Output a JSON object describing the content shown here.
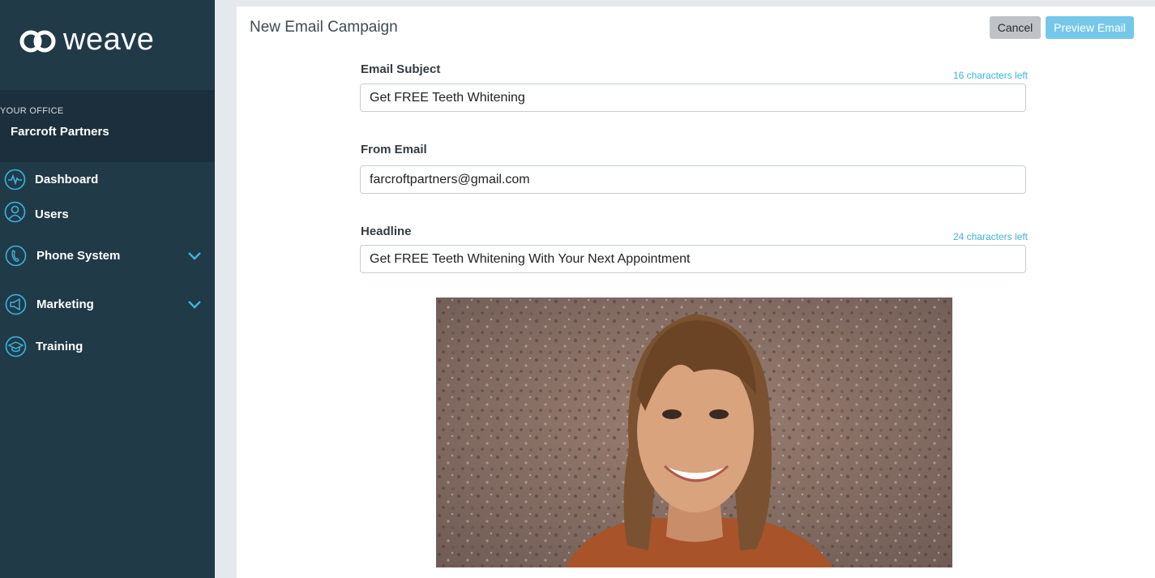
{
  "brand": {
    "name": "weave",
    "accent": "#3cb3df",
    "sidebar_bg": "#213a48"
  },
  "office": {
    "label": "YOUR OFFICE",
    "name": "Farcroft Partners"
  },
  "nav": [
    {
      "label": "Dashboard",
      "icon": "pulse-icon"
    },
    {
      "label": "Users",
      "icon": "user-icon"
    },
    {
      "label": "Phone System",
      "icon": "phone-icon",
      "expandable": true
    },
    {
      "label": "Marketing",
      "icon": "megaphone-icon",
      "expandable": true
    },
    {
      "label": "Training",
      "icon": "graduation-cap-icon"
    }
  ],
  "page": {
    "title": "New Email Campaign",
    "cancel_label": "Cancel",
    "preview_label": "Preview Email"
  },
  "form": {
    "subject": {
      "label": "Email Subject",
      "value": "Get FREE Teeth Whitening",
      "chars_left": "16 characters left"
    },
    "from": {
      "label": "From Email",
      "value": "farcroftpartners@gmail.com"
    },
    "headline": {
      "label": "Headline",
      "value": "Get FREE Teeth Whitening With Your Next Appointment",
      "chars_left": "24 characters left"
    }
  },
  "hero_image": {
    "icon": "smiling-woman-photo"
  }
}
